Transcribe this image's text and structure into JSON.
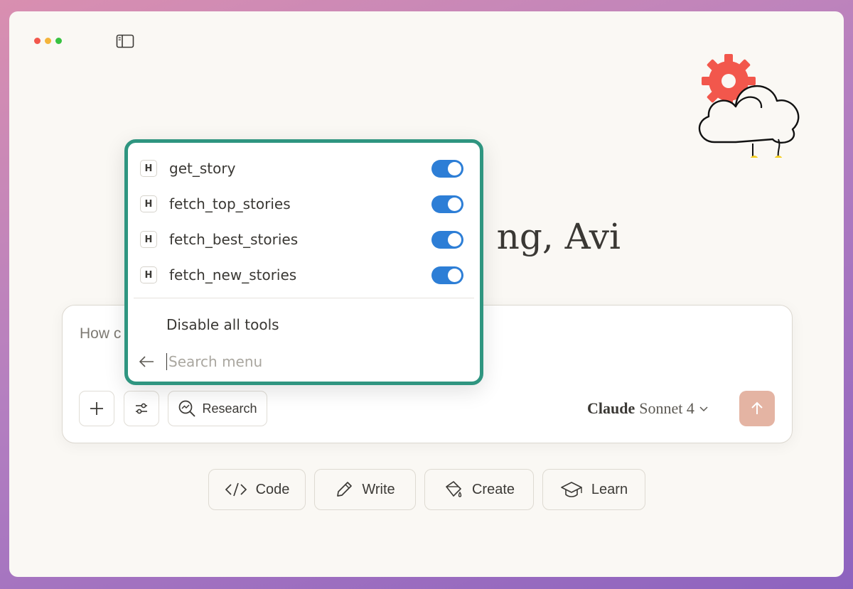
{
  "greeting": "ng, Avi",
  "composer": {
    "placeholder_visible": "How c"
  },
  "buttons": {
    "research": "Research"
  },
  "model": {
    "brand": "Claude",
    "name": "Sonnet 4"
  },
  "actions": [
    {
      "label": "Code",
      "icon": "code-icon"
    },
    {
      "label": "Write",
      "icon": "pencil-icon"
    },
    {
      "label": "Create",
      "icon": "paint-bucket-icon"
    },
    {
      "label": "Learn",
      "icon": "graduation-cap-icon"
    }
  ],
  "menu": {
    "tools": [
      {
        "badge": "H",
        "name": "get_story",
        "enabled": true
      },
      {
        "badge": "H",
        "name": "fetch_top_stories",
        "enabled": true
      },
      {
        "badge": "H",
        "name": "fetch_best_stories",
        "enabled": true
      },
      {
        "badge": "H",
        "name": "fetch_new_stories",
        "enabled": true
      }
    ],
    "disable_all": "Disable all tools",
    "search_placeholder": "Search menu"
  },
  "colors": {
    "accent_border": "#2f9580",
    "toggle_on": "#2d7ed6",
    "send_button": "#e4b4a3",
    "illustration_gear": "#f2574c"
  }
}
